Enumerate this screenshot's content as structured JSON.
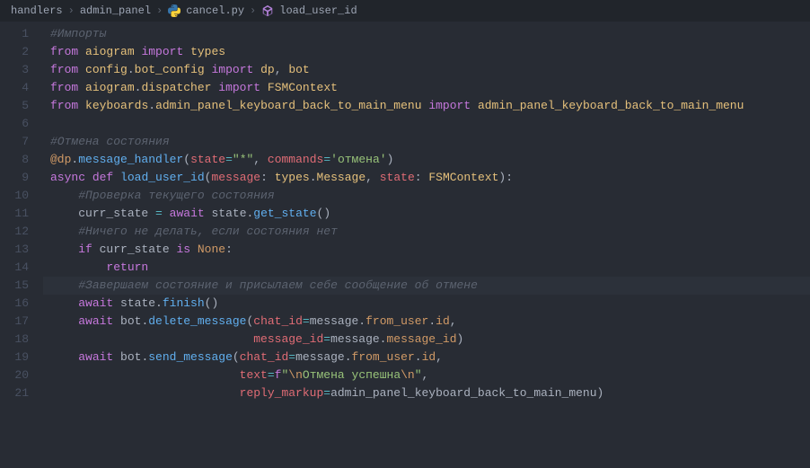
{
  "breadcrumbs": {
    "parts": [
      "handlers",
      "admin_panel",
      "cancel.py",
      "load_user_id"
    ]
  },
  "editor": {
    "active_line": 15,
    "lines": [
      {
        "n": 1,
        "tokens": [
          [
            "c-cmt",
            "#Импорты"
          ]
        ]
      },
      {
        "n": 2,
        "tokens": [
          [
            "c-key",
            "from"
          ],
          [
            "c-txt",
            " "
          ],
          [
            "c-mod",
            "aiogram"
          ],
          [
            "c-txt",
            " "
          ],
          [
            "c-key",
            "import"
          ],
          [
            "c-txt",
            " "
          ],
          [
            "c-mod",
            "types"
          ]
        ]
      },
      {
        "n": 3,
        "tokens": [
          [
            "c-key",
            "from"
          ],
          [
            "c-txt",
            " "
          ],
          [
            "c-mod",
            "config"
          ],
          [
            "c-txt",
            "."
          ],
          [
            "c-mod",
            "bot_config"
          ],
          [
            "c-txt",
            " "
          ],
          [
            "c-key",
            "import"
          ],
          [
            "c-txt",
            " "
          ],
          [
            "c-mod",
            "dp"
          ],
          [
            "c-txt",
            ", "
          ],
          [
            "c-mod",
            "bot"
          ]
        ]
      },
      {
        "n": 4,
        "tokens": [
          [
            "c-key",
            "from"
          ],
          [
            "c-txt",
            " "
          ],
          [
            "c-mod",
            "aiogram"
          ],
          [
            "c-txt",
            "."
          ],
          [
            "c-mod",
            "dispatcher"
          ],
          [
            "c-txt",
            " "
          ],
          [
            "c-key",
            "import"
          ],
          [
            "c-txt",
            " "
          ],
          [
            "c-mod",
            "FSMContext"
          ]
        ]
      },
      {
        "n": 5,
        "tokens": [
          [
            "c-key",
            "from"
          ],
          [
            "c-txt",
            " "
          ],
          [
            "c-mod",
            "keyboards"
          ],
          [
            "c-txt",
            "."
          ],
          [
            "c-mod",
            "admin_panel_keyboard_back_to_main_menu"
          ],
          [
            "c-txt",
            " "
          ],
          [
            "c-key",
            "import"
          ],
          [
            "c-txt",
            " "
          ],
          [
            "c-mod",
            "admin_panel_keyboard_back_to_main_menu"
          ]
        ]
      },
      {
        "n": 6,
        "tokens": []
      },
      {
        "n": 7,
        "tokens": [
          [
            "c-cmt",
            "#Отмена состояния"
          ]
        ]
      },
      {
        "n": 8,
        "tokens": [
          [
            "c-attr",
            "@dp"
          ],
          [
            "c-txt",
            "."
          ],
          [
            "c-func",
            "message_handler"
          ],
          [
            "c-txt",
            "("
          ],
          [
            "c-param",
            "state"
          ],
          [
            "c-op",
            "="
          ],
          [
            "c-str",
            "\"*\""
          ],
          [
            "c-txt",
            ", "
          ],
          [
            "c-param",
            "commands"
          ],
          [
            "c-op",
            "="
          ],
          [
            "c-str",
            "'отмена'"
          ],
          [
            "c-txt",
            ")"
          ]
        ]
      },
      {
        "n": 9,
        "tokens": [
          [
            "c-key",
            "async"
          ],
          [
            "c-txt",
            " "
          ],
          [
            "c-key",
            "def"
          ],
          [
            "c-txt",
            " "
          ],
          [
            "c-func",
            "load_user_id"
          ],
          [
            "c-txt",
            "("
          ],
          [
            "c-param",
            "message"
          ],
          [
            "c-txt",
            ": "
          ],
          [
            "c-mod",
            "types"
          ],
          [
            "c-txt",
            "."
          ],
          [
            "c-mod",
            "Message"
          ],
          [
            "c-txt",
            ", "
          ],
          [
            "c-param",
            "state"
          ],
          [
            "c-txt",
            ": "
          ],
          [
            "c-mod",
            "FSMContext"
          ],
          [
            "c-txt",
            "):"
          ]
        ]
      },
      {
        "n": 10,
        "tokens": [
          [
            "c-txt",
            "    "
          ],
          [
            "c-cmt",
            "#Проверка текущего состояния"
          ]
        ]
      },
      {
        "n": 11,
        "tokens": [
          [
            "c-txt",
            "    "
          ],
          [
            "c-txt",
            "curr_state "
          ],
          [
            "c-op",
            "="
          ],
          [
            "c-txt",
            " "
          ],
          [
            "c-key",
            "await"
          ],
          [
            "c-txt",
            " state."
          ],
          [
            "c-func",
            "get_state"
          ],
          [
            "c-txt",
            "()"
          ]
        ]
      },
      {
        "n": 12,
        "tokens": [
          [
            "c-txt",
            "    "
          ],
          [
            "c-cmt",
            "#Ничего не делать, если состояния нет"
          ]
        ]
      },
      {
        "n": 13,
        "tokens": [
          [
            "c-txt",
            "    "
          ],
          [
            "c-key",
            "if"
          ],
          [
            "c-txt",
            " curr_state "
          ],
          [
            "c-key",
            "is"
          ],
          [
            "c-txt",
            " "
          ],
          [
            "c-const",
            "None"
          ],
          [
            "c-txt",
            ":"
          ]
        ]
      },
      {
        "n": 14,
        "tokens": [
          [
            "c-txt",
            "        "
          ],
          [
            "c-key",
            "return"
          ]
        ]
      },
      {
        "n": 15,
        "tokens": [
          [
            "c-txt",
            "    "
          ],
          [
            "c-cmt",
            "#Завершаем состояние и присылаем себе сообщение об отмене"
          ]
        ]
      },
      {
        "n": 16,
        "tokens": [
          [
            "c-txt",
            "    "
          ],
          [
            "c-key",
            "await"
          ],
          [
            "c-txt",
            " state."
          ],
          [
            "c-func",
            "finish"
          ],
          [
            "c-txt",
            "()"
          ]
        ]
      },
      {
        "n": 17,
        "tokens": [
          [
            "c-txt",
            "    "
          ],
          [
            "c-key",
            "await"
          ],
          [
            "c-txt",
            " bot."
          ],
          [
            "c-func",
            "delete_message"
          ],
          [
            "c-txt",
            "("
          ],
          [
            "c-param",
            "chat_id"
          ],
          [
            "c-op",
            "="
          ],
          [
            "c-txt",
            "message."
          ],
          [
            "c-attr",
            "from_user"
          ],
          [
            "c-txt",
            "."
          ],
          [
            "c-attr",
            "id"
          ],
          [
            "c-txt",
            ","
          ]
        ]
      },
      {
        "n": 18,
        "tokens": [
          [
            "c-txt",
            "                             "
          ],
          [
            "c-param",
            "message_id"
          ],
          [
            "c-op",
            "="
          ],
          [
            "c-txt",
            "message."
          ],
          [
            "c-attr",
            "message_id"
          ],
          [
            "c-txt",
            ")"
          ]
        ]
      },
      {
        "n": 19,
        "tokens": [
          [
            "c-txt",
            "    "
          ],
          [
            "c-key",
            "await"
          ],
          [
            "c-txt",
            " bot."
          ],
          [
            "c-func",
            "send_message"
          ],
          [
            "c-txt",
            "("
          ],
          [
            "c-param",
            "chat_id"
          ],
          [
            "c-op",
            "="
          ],
          [
            "c-txt",
            "message."
          ],
          [
            "c-attr",
            "from_user"
          ],
          [
            "c-txt",
            "."
          ],
          [
            "c-attr",
            "id"
          ],
          [
            "c-txt",
            ","
          ]
        ]
      },
      {
        "n": 20,
        "tokens": [
          [
            "c-txt",
            "                           "
          ],
          [
            "c-param",
            "text"
          ],
          [
            "c-op",
            "="
          ],
          [
            "c-key",
            "f"
          ],
          [
            "c-str",
            "\""
          ],
          [
            "c-const",
            "\\n"
          ],
          [
            "c-str",
            "Отмена успешна"
          ],
          [
            "c-const",
            "\\n"
          ],
          [
            "c-str",
            "\""
          ],
          [
            "c-txt",
            ","
          ]
        ]
      },
      {
        "n": 21,
        "tokens": [
          [
            "c-txt",
            "                           "
          ],
          [
            "c-param",
            "reply_markup"
          ],
          [
            "c-op",
            "="
          ],
          [
            "c-txt",
            "admin_panel_keyboard_back_to_main_menu)"
          ]
        ]
      }
    ]
  }
}
